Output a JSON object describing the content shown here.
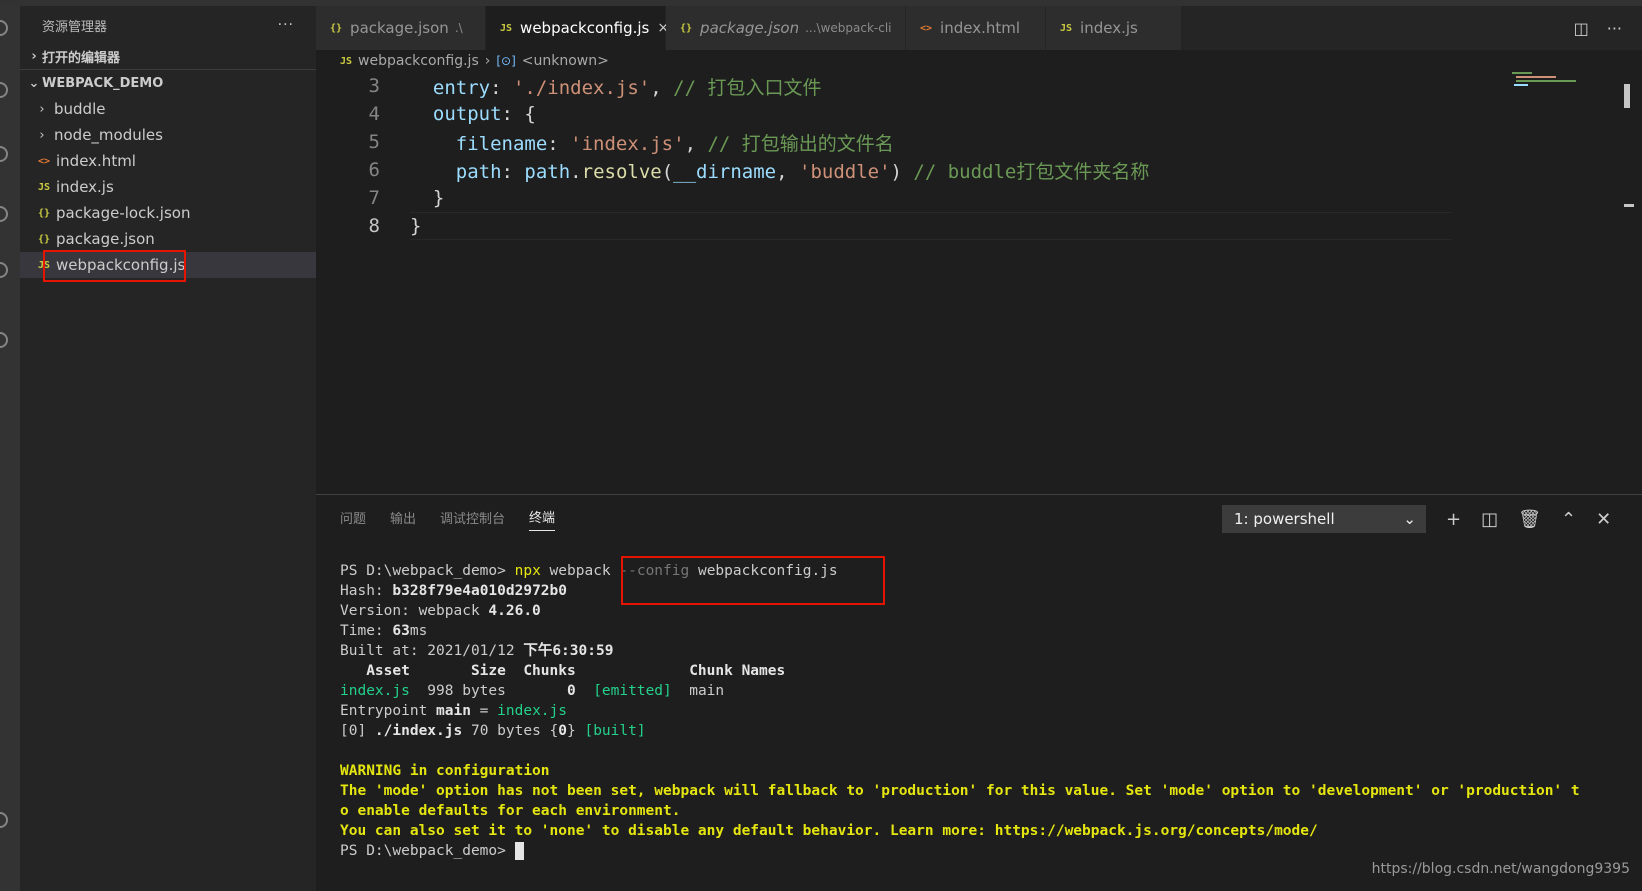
{
  "sidebar": {
    "title": "资源管理器",
    "more": "···",
    "open_editors": "打开的编辑器",
    "project": "WEBPACK_DEMO",
    "items": [
      {
        "type": "folder",
        "label": "buddle"
      },
      {
        "type": "folder",
        "label": "node_modules"
      },
      {
        "type": "html",
        "icon": "<>",
        "label": "index.html"
      },
      {
        "type": "js",
        "icon": "JS",
        "label": "index.js"
      },
      {
        "type": "json",
        "icon": "{}",
        "label": "package-lock.json"
      },
      {
        "type": "json",
        "icon": "{}",
        "label": "package.json"
      },
      {
        "type": "js",
        "icon": "JS",
        "label": "webpackconfig.js"
      }
    ]
  },
  "tabs": [
    {
      "icon": "{}",
      "label": "package.json",
      "suffix": ".\\"
    },
    {
      "icon": "JS",
      "label": "webpackconfig.js",
      "close": "×"
    },
    {
      "icon": "{}",
      "label": "package.json",
      "suffix": "...\\webpack-cli"
    },
    {
      "icon": "<>",
      "label": "index.html"
    },
    {
      "icon": "JS",
      "label": "index.js"
    }
  ],
  "breadcrumb": {
    "file": "webpackconfig.js",
    "symbol": "<unknown>"
  },
  "editor": {
    "lines": [
      {
        "n": "3",
        "tokens": [
          [
            "k",
            "  entry"
          ],
          [
            "p",
            ": "
          ],
          [
            "s",
            "'./index.js'"
          ],
          [
            "p",
            ", "
          ],
          [
            "c",
            "// 打包入口文件"
          ]
        ]
      },
      {
        "n": "4",
        "tokens": [
          [
            "k",
            "  output"
          ],
          [
            "p",
            ": {"
          ]
        ]
      },
      {
        "n": "5",
        "tokens": [
          [
            "k",
            "    filename"
          ],
          [
            "p",
            ": "
          ],
          [
            "s",
            "'index.js'"
          ],
          [
            "p",
            ", "
          ],
          [
            "c",
            "// 打包输出的文件名"
          ]
        ]
      },
      {
        "n": "6",
        "tokens": [
          [
            "k",
            "    path"
          ],
          [
            "p",
            ": "
          ],
          [
            "k",
            "path"
          ],
          [
            "p",
            "."
          ],
          [
            "f",
            "resolve"
          ],
          [
            "p",
            "("
          ],
          [
            "k",
            "__dirname"
          ],
          [
            "p",
            ", "
          ],
          [
            "s",
            "'buddle'"
          ],
          [
            "p",
            ") "
          ],
          [
            "c",
            "// buddle打包文件夹名称"
          ]
        ]
      },
      {
        "n": "7",
        "tokens": [
          [
            "p",
            "  }"
          ]
        ]
      },
      {
        "n": "8",
        "tokens": [
          [
            "p",
            "}"
          ]
        ]
      }
    ]
  },
  "panel": {
    "tabs": [
      "问题",
      "输出",
      "调试控制台",
      "终端"
    ],
    "terminal_select": "1: powershell",
    "terminal_lines": [
      [
        [
          "",
          "PS D:\\webpack_demo> "
        ],
        [
          "y",
          "npx"
        ],
        [
          "",
          " webpack "
        ],
        [
          "grey",
          "--config"
        ],
        [
          "",
          " webpackconfig.js"
        ]
      ],
      [
        [
          "",
          "Hash: "
        ],
        [
          "b",
          "b328f79e4a010d2972b0"
        ]
      ],
      [
        [
          "",
          "Version: webpack "
        ],
        [
          "b",
          "4.26.0"
        ]
      ],
      [
        [
          "",
          "Time: "
        ],
        [
          "b",
          "63"
        ],
        [
          "",
          "ms"
        ]
      ],
      [
        [
          "",
          "Built at: 2021/01/12 "
        ],
        [
          "b",
          "下午6:30:59"
        ]
      ],
      [
        [
          "b",
          "   Asset       Size  Chunks             Chunk Names"
        ]
      ],
      [
        [
          "g",
          "index.js"
        ],
        [
          "",
          "  998 bytes       "
        ],
        [
          "b",
          "0"
        ],
        [
          "",
          "  "
        ],
        [
          "g",
          "[emitted]"
        ],
        [
          "",
          "  main"
        ]
      ],
      [
        [
          "",
          "Entrypoint "
        ],
        [
          "b",
          "main"
        ],
        [
          "",
          " = "
        ],
        [
          "g",
          "index.js"
        ]
      ],
      [
        [
          "",
          "[0] "
        ],
        [
          "b",
          "./index.js"
        ],
        [
          "",
          " 70 bytes {"
        ],
        [
          "b",
          "0"
        ],
        [
          "",
          "} "
        ],
        [
          "g",
          "[built]"
        ]
      ],
      [
        [
          "",
          ""
        ]
      ],
      [
        [
          "warn",
          "WARNING in configuration"
        ]
      ],
      [
        [
          "warn",
          "The 'mode' option has not been set, webpack will fallback to 'production' for this value. Set 'mode' option to 'development' or 'production' t"
        ]
      ],
      [
        [
          "warn",
          "o enable defaults for each environment."
        ]
      ],
      [
        [
          "warn",
          "You can also set it to 'none' to disable any default behavior. Learn more: https://webpack.js.org/concepts/mode/"
        ]
      ],
      [
        [
          "",
          "PS D:\\webpack_demo> "
        ],
        [
          "cursor",
          ""
        ]
      ]
    ]
  },
  "watermark": "https://blog.csdn.net/wangdong9395",
  "colors": {
    "highlight_box": "#e51400",
    "accent_js": "#cbcb41"
  }
}
